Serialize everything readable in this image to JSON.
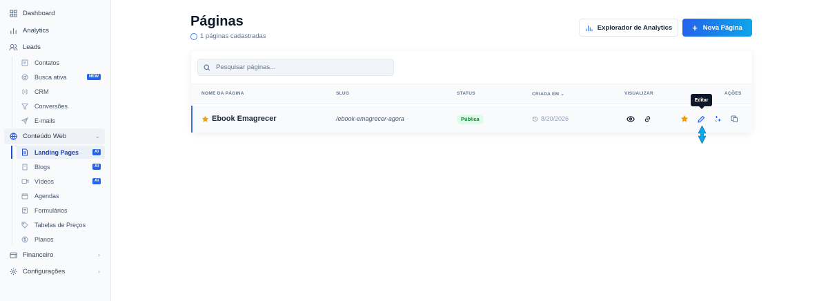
{
  "sidebar": {
    "items": [
      {
        "label": "Dashboard",
        "icon": "grid-icon"
      },
      {
        "label": "Analytics",
        "icon": "bar-chart-icon"
      },
      {
        "label": "Leads",
        "icon": "users-icon"
      }
    ],
    "leads_sub": [
      {
        "label": "Contatos",
        "icon": "contacts-icon"
      },
      {
        "label": "Busca ativa",
        "icon": "radar-icon",
        "badge": "NEW"
      },
      {
        "label": "CRM",
        "icon": "crm-icon"
      },
      {
        "label": "Conversões",
        "icon": "filter-icon"
      },
      {
        "label": "E-mails",
        "icon": "send-icon"
      }
    ],
    "web_section": {
      "label": "Conteúdo Web",
      "icon": "globe-icon"
    },
    "web_sub": [
      {
        "label": "Landing Pages",
        "icon": "file-icon",
        "badge": "AI",
        "active": true
      },
      {
        "label": "Blogs",
        "icon": "book-icon",
        "badge": "AI"
      },
      {
        "label": "Vídeos",
        "icon": "video-icon",
        "badge": "AI"
      },
      {
        "label": "Agendas",
        "icon": "calendar-icon"
      },
      {
        "label": "Formulários",
        "icon": "form-icon"
      },
      {
        "label": "Tabelas de Preços",
        "icon": "tag-icon"
      },
      {
        "label": "Planos",
        "icon": "dollar-icon"
      }
    ],
    "bottom": [
      {
        "label": "Financeiro",
        "icon": "wallet-icon"
      },
      {
        "label": "Configurações",
        "icon": "gear-icon"
      }
    ]
  },
  "header": {
    "title": "Páginas",
    "subtitle": "1 páginas cadastradas",
    "analytics_button": "Explorador de Analytics",
    "new_button": "Nova Página"
  },
  "search": {
    "placeholder": "Pesquisar páginas..."
  },
  "table": {
    "columns": [
      "NOME DA PÁGINA",
      "SLUG",
      "STATUS",
      "CRIADA EM",
      "VISUALIZAR",
      "AÇÕES"
    ],
    "rows": [
      {
        "name": "Ebook Emagrecer",
        "slug": "/ebook-emagrecer-agora",
        "status": "Pública",
        "created": "8/20/2026"
      }
    ]
  },
  "tooltip": "Editar",
  "colors": {
    "accent": "#2563eb",
    "favorite": "#f59e0b",
    "status_green": "#15803d"
  }
}
